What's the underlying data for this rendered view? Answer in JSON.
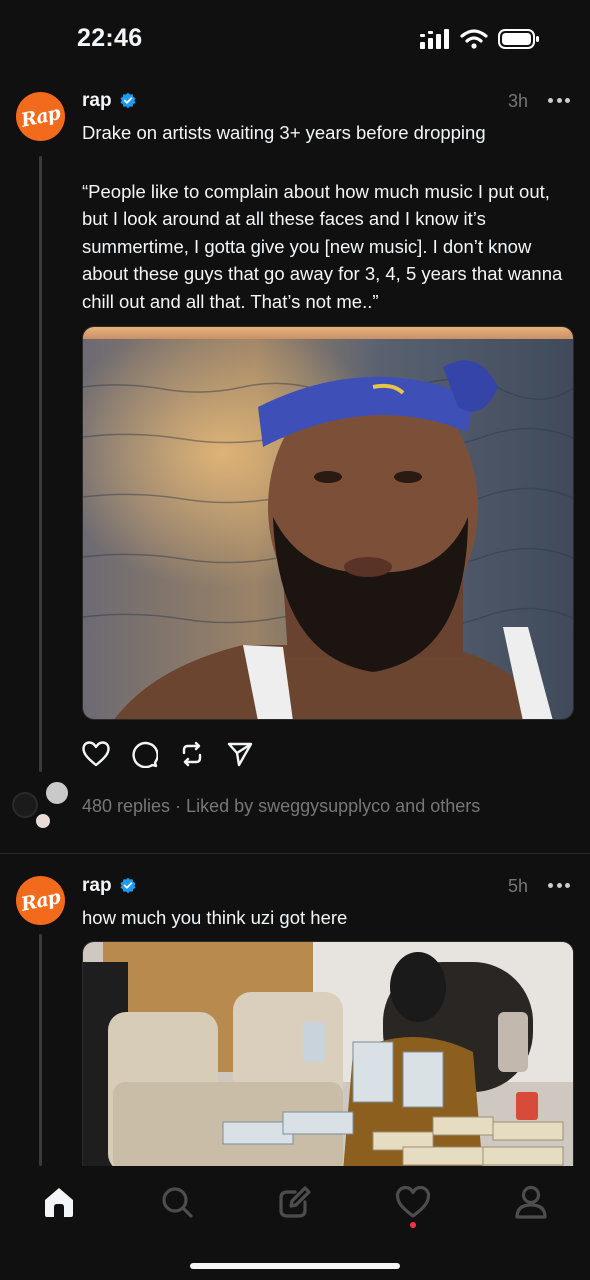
{
  "status_bar": {
    "time": "22:46"
  },
  "posts": [
    {
      "username": "rap",
      "avatar_text": "Rap",
      "time": "3h",
      "headline": "Drake on artists waiting 3+ years before dropping",
      "body": "“People like to complain about how much music I put out, but I look around at all these faces and I know it’s summertime, I gotta give you [new music]. I don’t know about these guys that go away for 3, 4, 5 years that wanna chill out and all that. That’s not me..”",
      "stats": "480 replies · Liked by sweggysupplyco and others"
    },
    {
      "username": "rap",
      "avatar_text": "Rap",
      "time": "5h",
      "headline": "how much you think uzi got here"
    }
  ],
  "icons": {
    "verified": "verified-badge-icon",
    "more": "more-dots-icon",
    "like": "heart-icon",
    "reply": "comment-icon",
    "repost": "repost-icon",
    "share": "send-icon"
  },
  "nav": [
    "home-icon",
    "search-icon",
    "compose-icon",
    "activity-icon",
    "profile-icon"
  ],
  "colors": {
    "background": "#101010",
    "brand_avatar": "#f26a1b",
    "verified": "#1d9bf0",
    "notification": "#ff3040"
  }
}
